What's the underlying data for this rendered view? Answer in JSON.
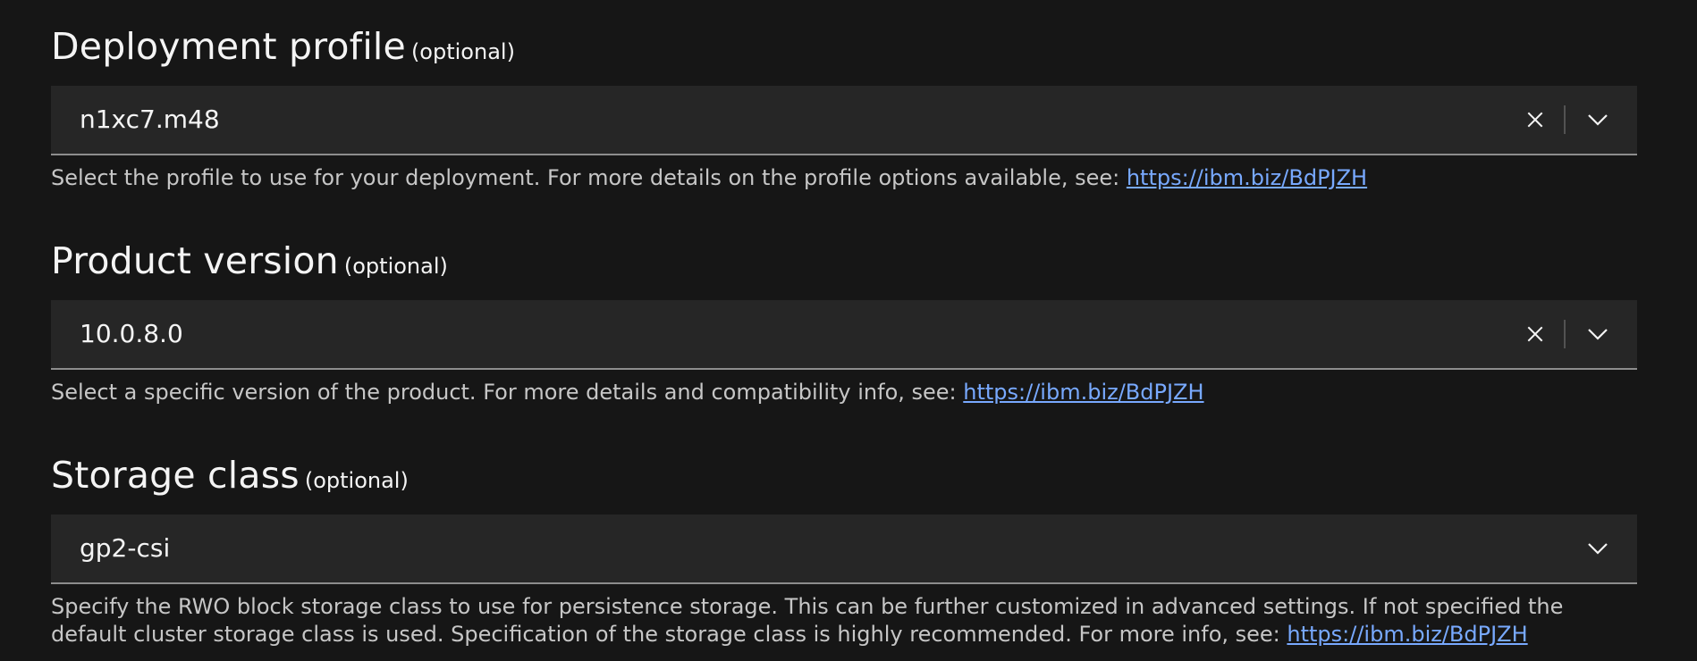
{
  "fields": [
    {
      "label": "Deployment profile",
      "optional": "(optional)",
      "value": "n1xc7.m48",
      "clearable": true,
      "helper_text": "Select the profile to use for your deployment. For more details on the profile options available, see: ",
      "helper_link": "https://ibm.biz/BdPJZH"
    },
    {
      "label": "Product version",
      "optional": "(optional)",
      "value": "10.0.8.0",
      "clearable": true,
      "helper_text": "Select a specific version of the product. For more details and compatibility info, see: ",
      "helper_link": "https://ibm.biz/BdPJZH"
    },
    {
      "label": "Storage class",
      "optional": "(optional)",
      "value": "gp2-csi",
      "clearable": false,
      "helper_text": "Specify the RWO block storage class to use for persistence storage. This can be further customized in advanced settings. If not specified the default cluster storage class is used. Specification of the storage class is highly recommended. For more info, see: ",
      "helper_link": "https://ibm.biz/BdPJZH"
    }
  ],
  "icons": {
    "clear": "close-icon",
    "open": "chevron-down-icon"
  },
  "colors": {
    "background": "#161616",
    "field_background": "#262626",
    "link": "#78a9ff",
    "helper_text": "#c6c6c6"
  }
}
